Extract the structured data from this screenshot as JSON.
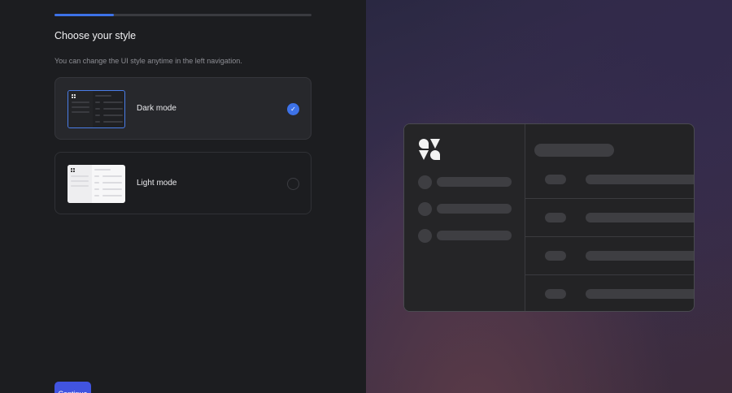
{
  "progress": {
    "value": 0.23
  },
  "header": {
    "title": "Choose your style",
    "subtitle": "You can change the UI style anytime in the left navigation."
  },
  "options": [
    {
      "label": "Dark mode",
      "selected": true,
      "thumb_icon": "dark-mode-thumbnail"
    },
    {
      "label": "Light mode",
      "selected": false,
      "thumb_icon": "light-mode-thumbnail"
    }
  ],
  "continue_label": "Continue",
  "colors": {
    "accent": "#3d72e8",
    "button": "#4154e0",
    "panel_bg": "#1c1d20"
  },
  "preview": {
    "logo_icon": "brand-logo-icon"
  }
}
